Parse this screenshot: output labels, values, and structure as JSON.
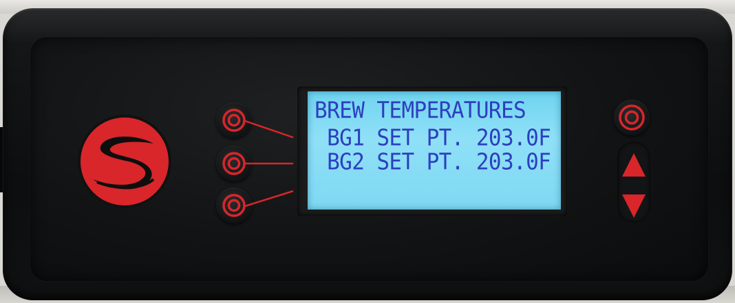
{
  "display": {
    "lines": [
      "BREW TEMPERATURES",
      " BG1 SET PT. 203.0F",
      " BG2 SET PT. 203.0F"
    ]
  },
  "icons": {
    "logo": "brand-s-logo",
    "left_buttons": [
      "select-button-icon",
      "select-button-icon",
      "select-button-icon"
    ],
    "right_top": "menu-button-icon",
    "up": "up-arrow-icon",
    "down": "down-arrow-icon"
  },
  "colors": {
    "accent_red": "#d8262b",
    "lcd_text": "#2d3fbf",
    "lcd_backlight": "#86dcf4",
    "panel": "#121314"
  }
}
